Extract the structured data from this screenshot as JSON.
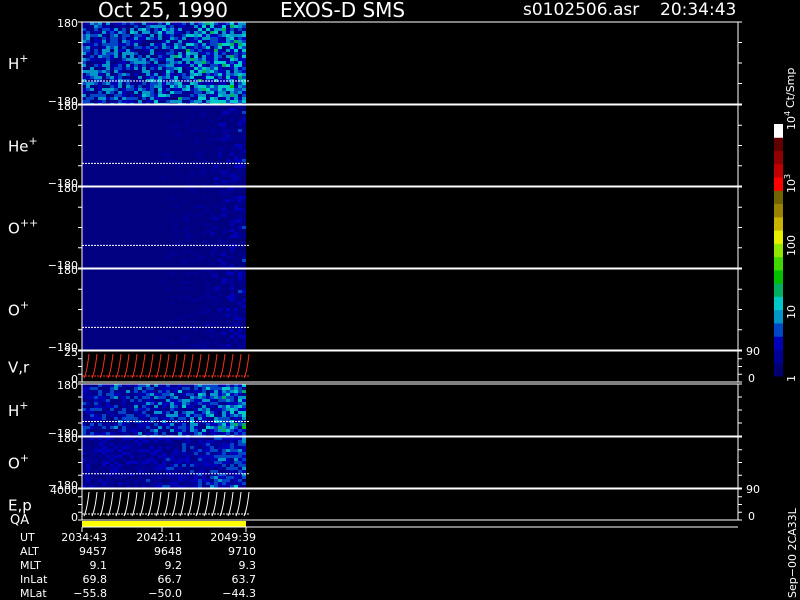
{
  "header": {
    "date": "Oct 25, 1990",
    "instrument": "EXOS-D SMS",
    "file": "s0102506.asr",
    "time": "20:34:43"
  },
  "colorbar": {
    "label": "Ct/Smp",
    "ticks": [
      {
        "value": 1,
        "text": "1"
      },
      {
        "value": 10,
        "text": "10"
      },
      {
        "value": 100,
        "text": "100"
      },
      {
        "value": 1000,
        "text": "10",
        "sup": "3"
      },
      {
        "value": 10000,
        "text": "10",
        "sup": "4"
      }
    ],
    "colors": [
      "#000070",
      "#000095",
      "#0000b8",
      "#0047c8",
      "#0096c8",
      "#00c8c8",
      "#00b060",
      "#00c000",
      "#40d800",
      "#90e800",
      "#e8f000",
      "#c8b400",
      "#988400",
      "#706400",
      "#ff0000",
      "#c00000",
      "#900000",
      "#600000",
      "#ffffff"
    ]
  },
  "panels": [
    {
      "id": "h-plus-1",
      "label": "H",
      "sup": "+",
      "ymax": "180",
      "ymin": "−180",
      "intensity": 0.55,
      "fade": 0.35
    },
    {
      "id": "he-plus",
      "label": "He",
      "sup": "+",
      "ymax": "180",
      "ymin": "−180",
      "intensity": 0.05,
      "fade": 0.3
    },
    {
      "id": "o-plusplus",
      "label": "O",
      "sup": "++",
      "ymax": "180",
      "ymin": "−180",
      "intensity": 0.05,
      "fade": 0.3
    },
    {
      "id": "o-plus-1",
      "label": "O",
      "sup": "+",
      "ymax": "180",
      "ymin": "−180",
      "intensity": 0.05,
      "fade": 0.3
    },
    {
      "id": "v-r",
      "label": "V,r",
      "sup": "",
      "ymax": "25",
      "ymin": "0",
      "right_max": "90",
      "right_min": "0",
      "intensity": 0,
      "fade": 0
    },
    {
      "id": "h-plus-2",
      "label": "H",
      "sup": "+",
      "ymax": "180",
      "ymin": "−180",
      "intensity": 0.45,
      "fade": 0.4
    },
    {
      "id": "o-plus-2",
      "label": "O",
      "sup": "+",
      "ymax": "180",
      "ymin": "−180",
      "intensity": 0.3,
      "fade": 0.3
    },
    {
      "id": "e-p",
      "label": "E,p",
      "sup": "",
      "ymax": "4000",
      "ymin": "0",
      "right_max": "90",
      "right_min": "0",
      "intensity": 0,
      "fade": 0
    }
  ],
  "qa_label": "QA",
  "side_note": "Sep−00 2CA33L",
  "ephemeris": {
    "rows": [
      {
        "name": "UT",
        "values": [
          "2034:43",
          "2042:11",
          "2049:39"
        ]
      },
      {
        "name": "ALT",
        "values": [
          "9457",
          "9648",
          "9710"
        ]
      },
      {
        "name": "MLT",
        "values": [
          "9.1",
          "9.2",
          "9.3"
        ]
      },
      {
        "name": "InLat",
        "values": [
          "69.8",
          "66.7",
          "63.7"
        ]
      },
      {
        "name": "MLat",
        "values": [
          "−55.8",
          "−50.0",
          "−44.3"
        ]
      }
    ]
  },
  "chart_data": {
    "type": "heatmap",
    "x_ticks_ut": [
      "2034:43",
      "2042:11",
      "2049:39"
    ],
    "series": [
      {
        "name": "H+"
      },
      {
        "name": "He+"
      },
      {
        "name": "O++"
      },
      {
        "name": "O+"
      },
      {
        "name": "V,r"
      },
      {
        "name": "H+"
      },
      {
        "name": "O+"
      },
      {
        "name": "E,p"
      }
    ],
    "color_scale": "log",
    "color_range": [
      1,
      10000
    ],
    "grid": false
  }
}
